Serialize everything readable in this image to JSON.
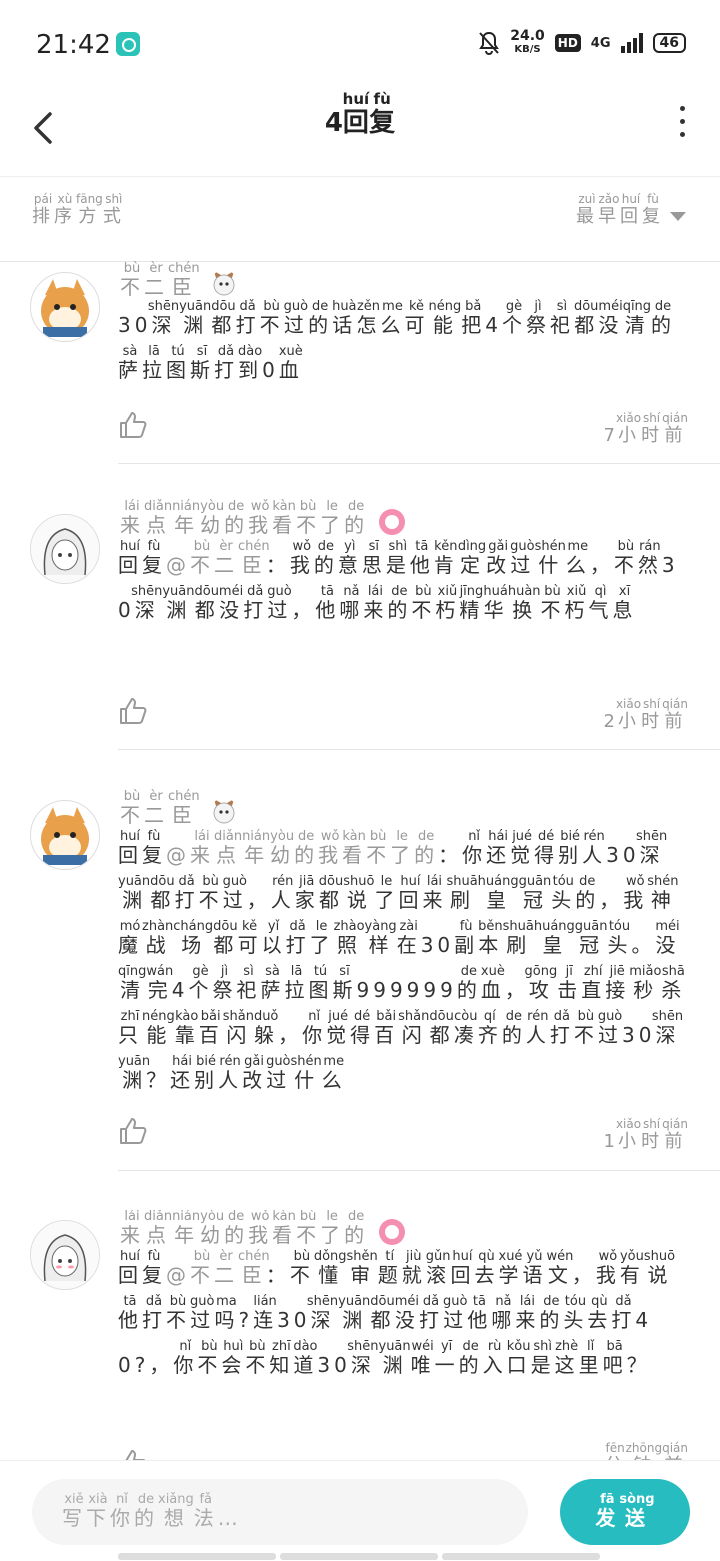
{
  "status_bar": {
    "time": "21:42",
    "net_speed": "24.0",
    "net_unit": "KB/S",
    "hd": "HD",
    "network": "4G",
    "battery": "46"
  },
  "header": {
    "count": "4",
    "title_ruby": [
      [
        "回",
        "huí"
      ],
      [
        "复",
        "fù"
      ]
    ]
  },
  "sort": {
    "label_ruby": [
      [
        "排",
        "pái"
      ],
      [
        "序",
        "xù"
      ],
      [
        "方",
        "fāng"
      ],
      [
        "式",
        "shì"
      ]
    ],
    "value_ruby": [
      [
        "最",
        "zuì"
      ],
      [
        "早",
        "zǎo"
      ],
      [
        "回",
        "huí"
      ],
      [
        "复",
        "fù"
      ]
    ]
  },
  "comments": [
    {
      "username_ruby": [
        [
          "不",
          "bù"
        ],
        [
          "二",
          "èr"
        ],
        [
          "臣",
          "chén"
        ]
      ],
      "text_ruby": [
        [
          "30",
          ""
        ],
        [
          "深",
          "shēn"
        ],
        [
          "渊",
          "yuān"
        ],
        [
          "都",
          "dōu"
        ],
        [
          "打",
          "dǎ"
        ],
        [
          "不",
          "bù"
        ],
        [
          "过",
          "guò"
        ],
        [
          "的",
          "de"
        ],
        [
          "话",
          "huà"
        ],
        [
          "怎",
          "zěn"
        ],
        [
          "么",
          "me"
        ],
        [
          "可",
          "kě"
        ],
        [
          "能",
          "néng"
        ],
        [
          "把",
          "bǎ"
        ],
        [
          "4",
          ""
        ],
        [
          "个",
          "gè"
        ],
        [
          "祭",
          "jì"
        ],
        [
          "祀",
          "sì"
        ],
        [
          "都",
          "dōu"
        ],
        [
          "没",
          "méi"
        ],
        [
          "清",
          "qīng"
        ],
        [
          "的",
          "de"
        ],
        [
          "萨",
          "sà"
        ],
        [
          "拉",
          "lā"
        ],
        [
          "图",
          "tú"
        ],
        [
          "斯",
          "sī"
        ],
        [
          "打",
          "dǎ"
        ],
        [
          "到",
          "dào"
        ],
        [
          "0",
          ""
        ],
        [
          "血",
          "xuè"
        ]
      ],
      "time_num": "7",
      "time_ruby": [
        [
          "小",
          "xiǎo"
        ],
        [
          "时",
          "shí"
        ],
        [
          "前",
          "qián"
        ]
      ]
    },
    {
      "username_ruby": [
        [
          "来",
          "lái"
        ],
        [
          "点",
          "diǎn"
        ],
        [
          "年",
          "nián"
        ],
        [
          "幼",
          "yòu"
        ],
        [
          "的",
          "de"
        ],
        [
          "我",
          "wǒ"
        ],
        [
          "看",
          "kàn"
        ],
        [
          "不",
          "bù"
        ],
        [
          "了",
          "le"
        ],
        [
          "的",
          "de"
        ]
      ],
      "reply_ruby": [
        [
          "回",
          "huí"
        ],
        [
          "复",
          "fù"
        ]
      ],
      "mention_ruby": [
        [
          "@",
          ""
        ],
        [
          "不",
          "bù"
        ],
        [
          "二",
          "èr"
        ],
        [
          "臣",
          "chén"
        ]
      ],
      "text_ruby": [
        [
          "：",
          ""
        ],
        [
          "我",
          "wǒ"
        ],
        [
          "的",
          "de"
        ],
        [
          "意",
          "yì"
        ],
        [
          "思",
          "sī"
        ],
        [
          "是",
          "shì"
        ],
        [
          "他",
          "tā"
        ],
        [
          "肯",
          "kěn"
        ],
        [
          "定",
          "dìng"
        ],
        [
          "改",
          "gǎi"
        ],
        [
          "过",
          "guò"
        ],
        [
          "什",
          "shén"
        ],
        [
          "么",
          "me"
        ],
        [
          "，",
          ""
        ],
        [
          "不",
          "bù"
        ],
        [
          "然",
          "rán"
        ],
        [
          "30",
          ""
        ],
        [
          "深",
          "shēn"
        ],
        [
          "渊",
          "yuān"
        ],
        [
          "都",
          "dōu"
        ],
        [
          "没",
          "méi"
        ],
        [
          "打",
          "dǎ"
        ],
        [
          "过",
          "guò"
        ],
        [
          "，",
          ""
        ],
        [
          "他",
          "tā"
        ],
        [
          "哪",
          "nǎ"
        ],
        [
          "来",
          "lái"
        ],
        [
          "的",
          "de"
        ],
        [
          "不",
          "bù"
        ],
        [
          "朽",
          "xiǔ"
        ],
        [
          "精",
          "jīng"
        ],
        [
          "华",
          "huá"
        ],
        [
          "换",
          "huàn"
        ],
        [
          "不",
          "bù"
        ],
        [
          "朽",
          "xiǔ"
        ],
        [
          "气",
          "qì"
        ],
        [
          "息",
          "xī"
        ]
      ],
      "time_num": "2",
      "time_ruby": [
        [
          "小",
          "xiǎo"
        ],
        [
          "时",
          "shí"
        ],
        [
          "前",
          "qián"
        ]
      ]
    },
    {
      "username_ruby": [
        [
          "不",
          "bù"
        ],
        [
          "二",
          "èr"
        ],
        [
          "臣",
          "chén"
        ]
      ],
      "reply_ruby": [
        [
          "回",
          "huí"
        ],
        [
          "复",
          "fù"
        ]
      ],
      "mention_ruby": [
        [
          "@",
          ""
        ],
        [
          "来",
          "lái"
        ],
        [
          "点",
          "diǎn"
        ],
        [
          "年",
          "nián"
        ],
        [
          "幼",
          "yòu"
        ],
        [
          "的",
          "de"
        ],
        [
          "我",
          "wǒ"
        ],
        [
          "看",
          "kàn"
        ],
        [
          "不",
          "bù"
        ],
        [
          "了",
          "le"
        ],
        [
          "的",
          "de"
        ]
      ],
      "text_ruby": [
        [
          "：",
          ""
        ],
        [
          "你",
          "nǐ"
        ],
        [
          "还",
          "hái"
        ],
        [
          "觉",
          "jué"
        ],
        [
          "得",
          "dé"
        ],
        [
          "别",
          "bié"
        ],
        [
          "人",
          "rén"
        ],
        [
          "30",
          ""
        ],
        [
          "深",
          "shēn"
        ],
        [
          "渊",
          "yuān"
        ],
        [
          "都",
          "dōu"
        ],
        [
          "打",
          "dǎ"
        ],
        [
          "不",
          "bù"
        ],
        [
          "过",
          "guò"
        ],
        [
          "，",
          ""
        ],
        [
          "人",
          "rén"
        ],
        [
          "家",
          "jiā"
        ],
        [
          "都",
          "dōu"
        ],
        [
          "说",
          "shuō"
        ],
        [
          "了",
          "le"
        ],
        [
          "回",
          "huí"
        ],
        [
          "来",
          "lái"
        ],
        [
          "刷",
          "shuā"
        ],
        [
          "皇",
          "huáng"
        ],
        [
          "冠",
          "guān"
        ],
        [
          "头",
          "tóu"
        ],
        [
          "的",
          "de"
        ],
        [
          "，",
          ""
        ],
        [
          "我",
          "wǒ"
        ],
        [
          "神",
          "shén"
        ],
        [
          "魔",
          "mó"
        ],
        [
          "战",
          "zhàn"
        ],
        [
          "场",
          "cháng"
        ],
        [
          "都",
          "dōu"
        ],
        [
          "可",
          "kě"
        ],
        [
          "以",
          "yǐ"
        ],
        [
          "打",
          "dǎ"
        ],
        [
          "了",
          "le"
        ],
        [
          "照",
          "zhào"
        ],
        [
          "样",
          "yàng"
        ],
        [
          "在",
          "zài"
        ],
        [
          "30",
          ""
        ],
        [
          "副",
          "fù"
        ],
        [
          "本",
          "běn"
        ],
        [
          "刷",
          "shuā"
        ],
        [
          "皇",
          "huáng"
        ],
        [
          "冠",
          "guān"
        ],
        [
          "头",
          "tóu"
        ],
        [
          "。",
          ""
        ],
        [
          "没",
          "méi"
        ],
        [
          "清",
          "qīng"
        ],
        [
          "完",
          "wán"
        ],
        [
          "4",
          ""
        ],
        [
          "个",
          "gè"
        ],
        [
          "祭",
          "jì"
        ],
        [
          "祀",
          "sì"
        ],
        [
          "萨",
          "sà"
        ],
        [
          "拉",
          "lā"
        ],
        [
          "图",
          "tú"
        ],
        [
          "斯",
          "sī"
        ],
        [
          "999999",
          ""
        ],
        [
          "的",
          "de"
        ],
        [
          "血",
          "xuè"
        ],
        [
          "，",
          ""
        ],
        [
          "攻",
          "gōng"
        ],
        [
          "击",
          "jī"
        ],
        [
          "直",
          "zhí"
        ],
        [
          "接",
          "jiē"
        ],
        [
          "秒",
          "miǎo"
        ],
        [
          "杀",
          "shā"
        ],
        [
          "只",
          "zhī"
        ],
        [
          "能",
          "néng"
        ],
        [
          "靠",
          "kào"
        ],
        [
          "百",
          "bǎi"
        ],
        [
          "闪",
          "shǎn"
        ],
        [
          "躲",
          "duǒ"
        ],
        [
          "，",
          ""
        ],
        [
          "你",
          "nǐ"
        ],
        [
          "觉",
          "jué"
        ],
        [
          "得",
          "dé"
        ],
        [
          "百",
          "bǎi"
        ],
        [
          "闪",
          "shǎn"
        ],
        [
          "都",
          "dōu"
        ],
        [
          "凑",
          "còu"
        ],
        [
          "齐",
          "qí"
        ],
        [
          "的",
          "de"
        ],
        [
          "人",
          "rén"
        ],
        [
          "打",
          "dǎ"
        ],
        [
          "不",
          "bù"
        ],
        [
          "过",
          "guò"
        ],
        [
          "30",
          ""
        ],
        [
          "深",
          "shēn"
        ],
        [
          "渊",
          "yuān"
        ],
        [
          "？",
          ""
        ],
        [
          "还",
          "hái"
        ],
        [
          "别",
          "bié"
        ],
        [
          "人",
          "rén"
        ],
        [
          "改",
          "gǎi"
        ],
        [
          "过",
          "guò"
        ],
        [
          "什",
          "shén"
        ],
        [
          "么",
          "me"
        ]
      ],
      "time_num": "1",
      "time_ruby": [
        [
          "小",
          "xiǎo"
        ],
        [
          "时",
          "shí"
        ],
        [
          "前",
          "qián"
        ]
      ]
    },
    {
      "username_ruby": [
        [
          "来",
          "lái"
        ],
        [
          "点",
          "diǎn"
        ],
        [
          "年",
          "nián"
        ],
        [
          "幼",
          "yòu"
        ],
        [
          "的",
          "de"
        ],
        [
          "我",
          "wǒ"
        ],
        [
          "看",
          "kàn"
        ],
        [
          "不",
          "bù"
        ],
        [
          "了",
          "le"
        ],
        [
          "的",
          "de"
        ]
      ],
      "reply_ruby": [
        [
          "回",
          "huí"
        ],
        [
          "复",
          "fù"
        ]
      ],
      "mention_ruby": [
        [
          "@",
          ""
        ],
        [
          "不",
          "bù"
        ],
        [
          "二",
          "èr"
        ],
        [
          "臣",
          "chén"
        ]
      ],
      "text_ruby": [
        [
          "：",
          ""
        ],
        [
          "不",
          "bù"
        ],
        [
          "懂",
          "dǒng"
        ],
        [
          "审",
          "shěn"
        ],
        [
          "题",
          "tí"
        ],
        [
          "就",
          "jiù"
        ],
        [
          "滚",
          "gǔn"
        ],
        [
          "回",
          "huí"
        ],
        [
          "去",
          "qù"
        ],
        [
          "学",
          "xué"
        ],
        [
          "语",
          "yǔ"
        ],
        [
          "文",
          "wén"
        ],
        [
          "，",
          ""
        ],
        [
          "我",
          "wǒ"
        ],
        [
          "有",
          "yǒu"
        ],
        [
          "说",
          "shuō"
        ],
        [
          "他",
          "tā"
        ],
        [
          "打",
          "dǎ"
        ],
        [
          "不",
          "bù"
        ],
        [
          "过",
          "guò"
        ],
        [
          "吗",
          "ma"
        ],
        [
          "?",
          ""
        ],
        [
          "连",
          "lián"
        ],
        [
          "30",
          ""
        ],
        [
          "深",
          "shēn"
        ],
        [
          "渊",
          "yuān"
        ],
        [
          "都",
          "dōu"
        ],
        [
          "没",
          "méi"
        ],
        [
          "打",
          "dǎ"
        ],
        [
          "过",
          "guò"
        ],
        [
          "他",
          "tā"
        ],
        [
          "哪",
          "nǎ"
        ],
        [
          "来",
          "lái"
        ],
        [
          "的",
          "de"
        ],
        [
          "头",
          "tóu"
        ],
        [
          "去",
          "qù"
        ],
        [
          "打",
          "dǎ"
        ],
        [
          "40?",
          ""
        ],
        [
          "，",
          ""
        ],
        [
          "你",
          "nǐ"
        ],
        [
          "不",
          "bù"
        ],
        [
          "会",
          "huì"
        ],
        [
          "不",
          "bù"
        ],
        [
          "知",
          "zhī"
        ],
        [
          "道",
          "dào"
        ],
        [
          "30",
          ""
        ],
        [
          "深",
          "shēn"
        ],
        [
          "渊",
          "yuān"
        ],
        [
          "唯",
          "wéi"
        ],
        [
          "一",
          "yī"
        ],
        [
          "的",
          "de"
        ],
        [
          "入",
          "rù"
        ],
        [
          "口",
          "kǒu"
        ],
        [
          "是",
          "shì"
        ],
        [
          "这",
          "zhè"
        ],
        [
          "里",
          "lǐ"
        ],
        [
          "吧",
          "bā"
        ],
        [
          "？",
          ""
        ]
      ],
      "time_num": "",
      "time_ruby": [
        [
          "分",
          "fēn"
        ],
        [
          "钟",
          "zhōng"
        ],
        [
          "前",
          "qián"
        ]
      ]
    }
  ],
  "input": {
    "placeholder_ruby": [
      [
        "写",
        "xiě"
      ],
      [
        "下",
        "xià"
      ],
      [
        "你",
        "nǐ"
      ],
      [
        "的",
        "de"
      ],
      [
        "想",
        "xiǎng"
      ],
      [
        "法",
        "fǎ"
      ],
      [
        "…",
        ""
      ]
    ]
  },
  "send": {
    "label_ruby": [
      [
        "发",
        "fā"
      ],
      [
        "送",
        "sòng"
      ]
    ]
  },
  "colors": {
    "accent": "#26bcc0",
    "muted": "#999999",
    "text": "#333333"
  }
}
